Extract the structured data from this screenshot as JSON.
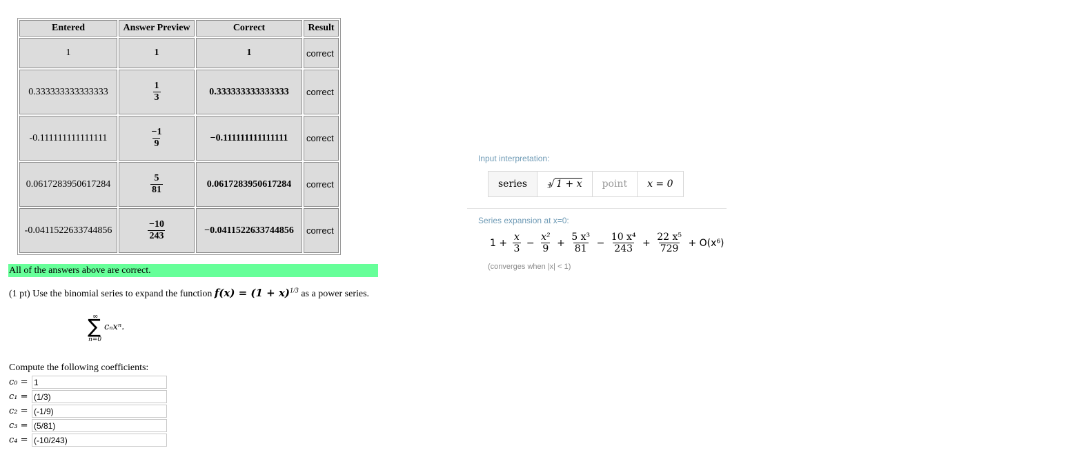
{
  "table": {
    "headers": [
      "Entered",
      "Answer Preview",
      "Correct",
      "Result"
    ],
    "rows": [
      {
        "entered": "1",
        "preview_num": "1",
        "preview_den": "",
        "correct": "1",
        "result": "correct"
      },
      {
        "entered": "0.333333333333333",
        "preview_num": "1",
        "preview_den": "3",
        "correct": "0.333333333333333",
        "result": "correct"
      },
      {
        "entered": "-0.111111111111111",
        "preview_num": "−1",
        "preview_den": "9",
        "correct": "−0.111111111111111",
        "result": "correct"
      },
      {
        "entered": "0.0617283950617284",
        "preview_num": "5",
        "preview_den": "81",
        "correct": "0.0617283950617284",
        "result": "correct"
      },
      {
        "entered": "-0.0411522633744856",
        "preview_num": "−10",
        "preview_den": "243",
        "correct": "−0.0411522633744856",
        "result": "correct"
      }
    ]
  },
  "status": {
    "all_correct": "All of the answers above are correct.",
    "color": "#66ff99"
  },
  "problem": {
    "prefix": "(1 pt) Use the binomial series to expand the function",
    "function_math": "f(x) = (1 + x)",
    "exponent": "1/3",
    "suffix": "as a power series."
  },
  "sum": {
    "upper": "∞",
    "sigma": "∑",
    "lower": "n=0",
    "term": "cₙxⁿ."
  },
  "compute": {
    "label": "Compute the following coefficients:",
    "coefficients": [
      {
        "label": "c₀ =",
        "value": "1"
      },
      {
        "label": "c₁ =",
        "value": "(1/3)"
      },
      {
        "label": "c₂ =",
        "value": "(-1/9)"
      },
      {
        "label": "c₃ =",
        "value": "(5/81)"
      },
      {
        "label": "c₄ =",
        "value": "(-10/243)"
      }
    ]
  },
  "wolfram": {
    "interp_title": "Input interpretation:",
    "interp_keyword": "series",
    "interp_function_index": "3",
    "interp_function_radicand": "1 + x",
    "interp_point_label": "point",
    "interp_point_value": "x = 0",
    "series_title": "Series expansion at x=0:",
    "terms": [
      {
        "lead": "1 +",
        "num": "x",
        "den": "3"
      },
      {
        "lead": "−",
        "num": "x²",
        "den": "9"
      },
      {
        "lead": "+",
        "num": "5 x³",
        "den": "81"
      },
      {
        "lead": "−",
        "num": "10 x⁴",
        "den": "243"
      },
      {
        "lead": "+",
        "num": "22 x⁵",
        "den": "729"
      }
    ],
    "tail": "+ O(x⁶)",
    "converges": "(converges when |x| < 1)"
  }
}
